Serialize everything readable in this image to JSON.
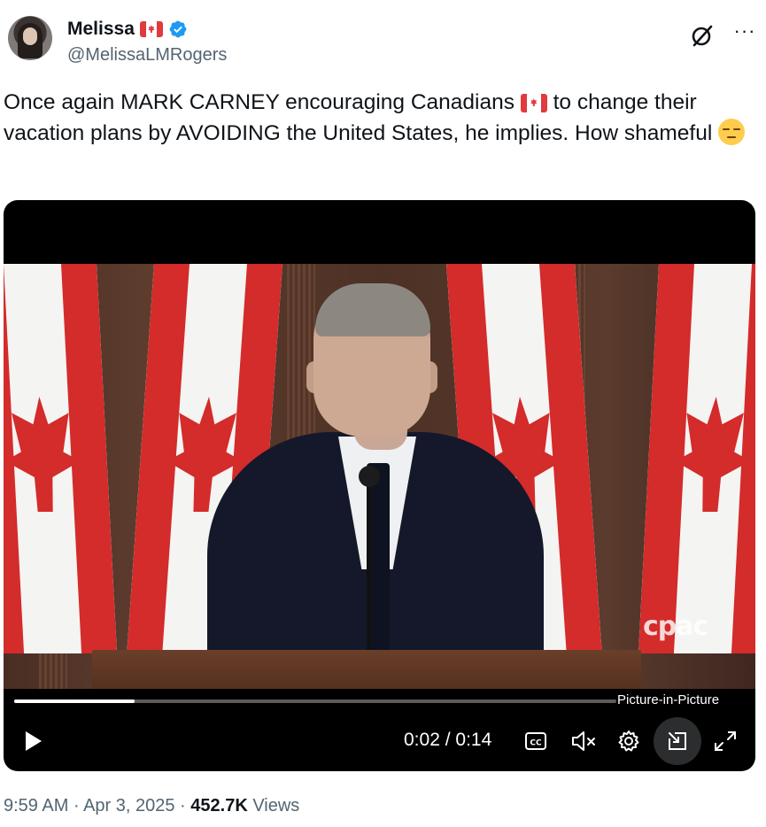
{
  "author": {
    "display_name": "Melissa",
    "handle": "@MelissaLMRogers",
    "verified": true,
    "name_emoji": "canada-flag"
  },
  "header_icons": [
    "grok-icon",
    "more-icon"
  ],
  "tweet": {
    "text_part1": "Once again MARK CARNEY encouraging Canadians ",
    "text_part2": " to change their vacation plans by AVOIDING the United States, he implies. How shameful ",
    "inline_emoji_1": "canada-flag",
    "inline_emoji_2": "unamused-face"
  },
  "video": {
    "watermark": "cpac",
    "current_time": "0:02",
    "separator": " / ",
    "duration": "0:14",
    "progress_fraction": 0.2,
    "tooltip": "Picture-in-Picture",
    "controls": [
      "play-icon",
      "captions-icon",
      "mute-icon",
      "settings-icon",
      "picture-in-picture-icon",
      "fullscreen-icon"
    ]
  },
  "meta": {
    "time": "9:59 AM",
    "dot1": " · ",
    "date": "Apr 3, 2025",
    "dot2": " · ",
    "views_count": "452.7K",
    "views_label": " Views"
  },
  "colors": {
    "text_primary": "#0f1419",
    "text_secondary": "#536471",
    "verified_blue": "#1d9bf0",
    "video_bg": "#000000"
  }
}
